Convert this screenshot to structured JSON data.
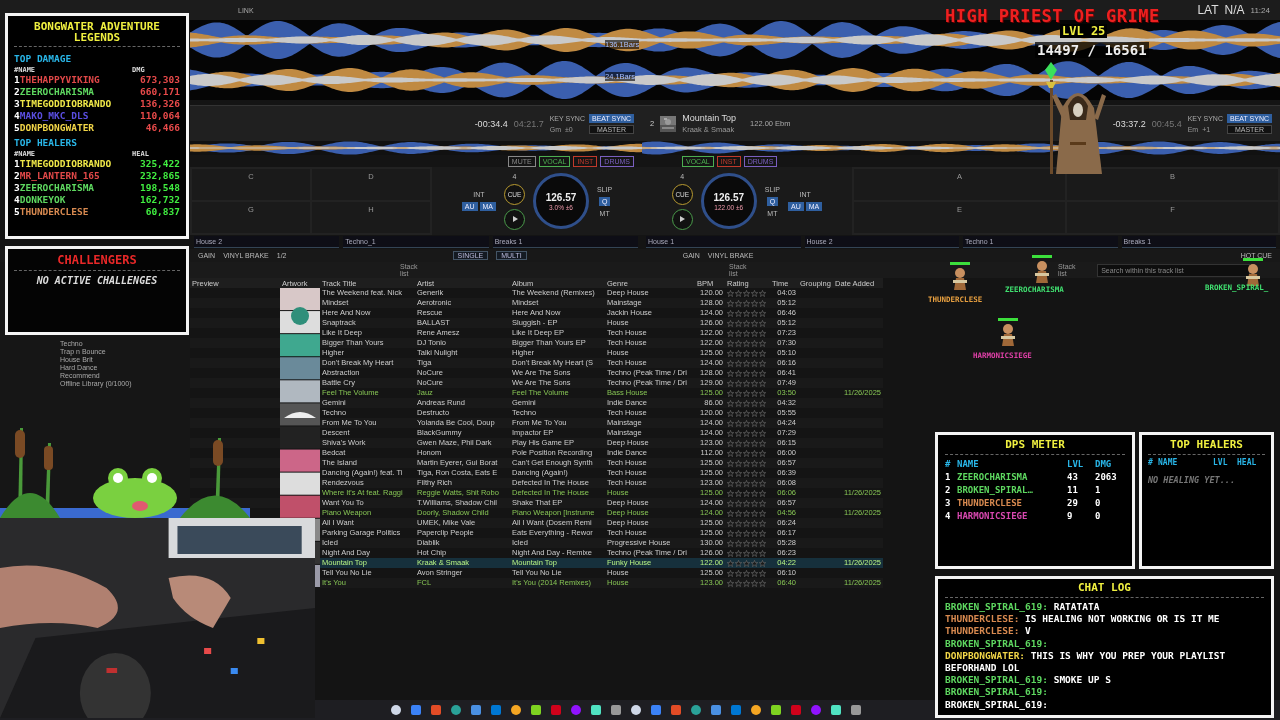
{
  "app": {
    "link_label": "LINK",
    "waveform_markers": [
      "136.1Bars",
      "24.1Bars"
    ],
    "status": {
      "lat_label": "LAT",
      "lat_value": "N/A",
      "clock": "11:24"
    },
    "decks": [
      {
        "time_remaining": "-00:34.4",
        "time_elapsed": "04:21.7",
        "key_sync": "KEY SYNC",
        "beat_sync": "BEAT SYNC",
        "master": "MASTER",
        "key": "Gm",
        "key_shift": "±0",
        "stems": [
          {
            "label": "MUTE",
            "color": "#888888"
          },
          {
            "label": "VOCAL",
            "color": "#4caf50"
          },
          {
            "label": "INST",
            "color": "#c0392b"
          },
          {
            "label": "DRUMS",
            "color": "#7a5fc0"
          }
        ],
        "pads": [
          "C",
          "D",
          "G",
          "H"
        ],
        "beat_jump": "4",
        "int": "INT",
        "cue": "CUE",
        "slip": "SLIP",
        "q": "Q",
        "modes": [
          "AU",
          "MA"
        ],
        "mt": "MT",
        "bpm": "126.57",
        "pitch": "3.0%",
        "range": "±6",
        "samples": [
          "House 2",
          "Techno_1",
          "Breaks 1"
        ]
      },
      {
        "number": "2",
        "title": "Mountain Top",
        "artist": "Kraak & Smaak",
        "track_info": "122.00 Ebm",
        "time_remaining": "-03:37.2",
        "time_elapsed": "00:45.4",
        "key_sync": "KEY SYNC",
        "beat_sync": "BEAT SYNC",
        "master": "MASTER",
        "key": "Em",
        "key_shift": "+1",
        "stems": [
          {
            "label": "VOCAL",
            "color": "#4caf50"
          },
          {
            "label": "INST",
            "color": "#c0392b"
          },
          {
            "label": "DRUMS",
            "color": "#7a5fc0"
          }
        ],
        "pads": [
          "A",
          "B",
          "E",
          "F"
        ],
        "beat_jump": "4",
        "int": "INT",
        "cue": "CUE",
        "slip": "SLIP",
        "q": "Q",
        "modes": [
          "AU",
          "MA"
        ],
        "mt": "MT",
        "bpm": "126.57",
        "pitch": "122.00",
        "range": "±6",
        "samples": [
          "House 1",
          "House 2",
          "Techno 1",
          "Breaks 1"
        ]
      }
    ],
    "strip_labels": {
      "left": [
        "GAIN",
        "VINYL BRAKE",
        "1/2"
      ],
      "center": [
        "SINGLE",
        "MULTI"
      ],
      "right": [
        "GAIN",
        "VINYL BRAKE"
      ],
      "hot_cue": "HOT CUE"
    },
    "stack_lists": [
      "Stack list",
      "Stack list",
      "Stack list"
    ],
    "search": {
      "placeholder": "Search within this track list"
    },
    "sidebar_items": [
      "Techno",
      "Trap n Bounce",
      "House Brit",
      "Hard Dance",
      "Recommend",
      "Offline Library (0/1000)"
    ],
    "table": {
      "columns": [
        "Preview",
        "Artwork",
        "Track Title",
        "Artist",
        "Album",
        "Genre",
        "BPM",
        "Rating",
        "Time",
        "Grouping",
        "Date Added"
      ],
      "rows": [
        {
          "title": "The Weekend feat. Nick",
          "artist": "Generik",
          "album": "The Weekend (Remixes)",
          "genre": "Deep House",
          "bpm": "120.00",
          "stars": 0,
          "time": "04:03",
          "played": false,
          "selected": false
        },
        {
          "title": "Mindset",
          "artist": "Aerotronic",
          "album": "Mindset",
          "genre": "Mainstage",
          "bpm": "128.00",
          "stars": 0,
          "time": "05:12",
          "played": false,
          "selected": false
        },
        {
          "title": "Here And Now",
          "artist": "Rescue",
          "album": "Here And Now",
          "genre": "Jackin House",
          "bpm": "124.00",
          "stars": 0,
          "time": "06:46",
          "played": false,
          "selected": false
        },
        {
          "title": "Snaptrack",
          "artist": "BALLAST",
          "album": "Sluggish - EP",
          "genre": "House",
          "bpm": "126.00",
          "stars": 0,
          "time": "05:12",
          "played": false,
          "selected": false
        },
        {
          "title": "Like It Deep",
          "artist": "Rene Amesz",
          "album": "Like It Deep EP",
          "genre": "Tech House",
          "bpm": "122.00",
          "stars": 0,
          "time": "07:23",
          "played": false,
          "selected": false
        },
        {
          "title": "Bigger Than Yours",
          "artist": "DJ Tonio",
          "album": "Bigger Than Yours EP",
          "genre": "Tech House",
          "bpm": "122.00",
          "stars": 0,
          "time": "07:30",
          "played": false,
          "selected": false
        },
        {
          "title": "Higher",
          "artist": "Talki Nulight",
          "album": "Higher",
          "genre": "House",
          "bpm": "125.00",
          "stars": 0,
          "time": "05:10",
          "played": false,
          "selected": false
        },
        {
          "title": "Don't Break My Heart",
          "artist": "Tiga",
          "album": "Don't Break My Heart (S",
          "genre": "Tech House",
          "bpm": "124.00",
          "stars": 0,
          "time": "06:16",
          "played": false,
          "selected": false
        },
        {
          "title": "Abstraction",
          "artist": "NoCure",
          "album": "We Are The Sons",
          "genre": "Techno (Peak Time / Dri",
          "bpm": "128.00",
          "stars": 0,
          "time": "06:41",
          "played": false,
          "selected": false
        },
        {
          "title": "Battle Cry",
          "artist": "NoCure",
          "album": "We Are The Sons",
          "genre": "Techno (Peak Time / Dri",
          "bpm": "129.00",
          "stars": 0,
          "time": "07:49",
          "played": false,
          "selected": false
        },
        {
          "title": "Feel The Volume",
          "artist": "Jauz",
          "album": "Feel The Volume",
          "genre": "Bass House",
          "bpm": "125.00",
          "stars": 0,
          "time": "03:50",
          "date_added": "11/26/2025",
          "played": true,
          "selected": false
        },
        {
          "title": "Gemini",
          "artist": "Andreas Rund",
          "album": "Gemini",
          "genre": "Indie Dance",
          "bpm": "86.00",
          "stars": 0,
          "time": "04:32",
          "played": false,
          "selected": false
        },
        {
          "title": "Techno",
          "artist": "Destructo",
          "album": "Techno",
          "genre": "Tech House",
          "bpm": "120.00",
          "stars": 0,
          "time": "05:55",
          "played": false,
          "selected": false
        },
        {
          "title": "From Me To You",
          "artist": "Yolanda Be Cool, Doup",
          "album": "From Me To You",
          "genre": "Mainstage",
          "bpm": "124.00",
          "stars": 0,
          "time": "04:24",
          "played": false,
          "selected": false
        },
        {
          "title": "Descent",
          "artist": "BlackGummy",
          "album": "Impactor EP",
          "genre": "Mainstage",
          "bpm": "124.00",
          "stars": 0,
          "time": "07:29",
          "played": false,
          "selected": false
        },
        {
          "title": "Shiva's Work",
          "artist": "Gwen Maze, Phil Dark",
          "album": "Play His Game EP",
          "genre": "Deep House",
          "bpm": "123.00",
          "stars": 0,
          "time": "06:15",
          "played": false,
          "selected": false
        },
        {
          "title": "Bedcat",
          "artist": "Honom",
          "album": "Pole Position Recording",
          "genre": "Indie Dance",
          "bpm": "112.00",
          "stars": 0,
          "time": "06:00",
          "played": false,
          "selected": false
        },
        {
          "title": "The Island",
          "artist": "Martin Eyerer, Gui Borat",
          "album": "Can't Get Enough Synth",
          "genre": "Tech House",
          "bpm": "125.00",
          "stars": 0,
          "time": "06:57",
          "played": false,
          "selected": false
        },
        {
          "title": "Dancing (Again!) feat. Ti",
          "artist": "Tiga, Ron Costa, Eats E",
          "album": "Dancing (Again!)",
          "genre": "Tech House",
          "bpm": "125.00",
          "stars": 0,
          "time": "06:39",
          "played": false,
          "selected": false
        },
        {
          "title": "Rendezvous",
          "artist": "Filthy Rich",
          "album": "Defected In The House",
          "genre": "Tech House",
          "bpm": "123.00",
          "stars": 0,
          "time": "06:08",
          "played": false,
          "selected": false
        },
        {
          "title": "Where It's At feat. Raggi",
          "artist": "Reggie Watts, Shit Robo",
          "album": "Defected In The House",
          "genre": "House",
          "bpm": "125.00",
          "stars": 0,
          "time": "06:06",
          "date_added": "11/26/2025",
          "played": true,
          "selected": false
        },
        {
          "title": "Want You To",
          "artist": "T.Williams, Shadow Chil",
          "album": "Shake That EP",
          "genre": "Deep House",
          "bpm": "124.00",
          "stars": 0,
          "time": "06:57",
          "played": false,
          "selected": false
        },
        {
          "title": "Piano Weapon",
          "artist": "Doorly, Shadow Child",
          "album": "Piano Weapon [Instrume",
          "genre": "Deep House",
          "bpm": "124.00",
          "stars": 0,
          "time": "04:56",
          "date_added": "11/26/2025",
          "played": true,
          "selected": false
        },
        {
          "title": "All I Want",
          "artist": "UMEK, Mike Vale",
          "album": "All I Want (Dosem Remi",
          "genre": "Deep House",
          "bpm": "125.00",
          "stars": 0,
          "time": "06:24",
          "played": false,
          "selected": false
        },
        {
          "title": "Parking Garage Politics",
          "artist": "Paperclip People",
          "album": "Eats Everything - Rewor",
          "genre": "Tech House",
          "bpm": "125.00",
          "stars": 0,
          "time": "06:17",
          "played": false,
          "selected": false
        },
        {
          "title": "Icled",
          "artist": "Diablik",
          "album": "Icled",
          "genre": "Progressive House",
          "bpm": "130.00",
          "stars": 0,
          "time": "05:28",
          "played": false,
          "selected": false
        },
        {
          "title": "Night And Day",
          "artist": "Hot Chip",
          "album": "Night And Day - Remixe",
          "genre": "Techno (Peak Time / Dri",
          "bpm": "126.00",
          "stars": 0,
          "time": "06:23",
          "played": false,
          "selected": false
        },
        {
          "title": "Mountain Top",
          "artist": "Kraak & Smaak",
          "album": "Mountain Top",
          "genre": "Funky House",
          "bpm": "122.00",
          "stars": 0,
          "time": "04:22",
          "date_added": "11/26/2025",
          "played": true,
          "selected": true
        },
        {
          "title": "Tell You No Lie",
          "artist": "Avon Stringer",
          "album": "Tell You No Lie",
          "genre": "House",
          "bpm": "125.00",
          "stars": 0,
          "time": "06:10",
          "played": false,
          "selected": false
        },
        {
          "title": "It's You",
          "artist": "FCL",
          "album": "It's You (2014 Remixes)",
          "genre": "House",
          "bpm": "123.00",
          "stars": 0,
          "time": "06:40",
          "date_added": "11/26/2025",
          "played": true,
          "selected": false
        }
      ]
    }
  },
  "overlay": {
    "leaderboard": {
      "title": "BONGWATER ADVENTURE LEGENDS",
      "sections": [
        {
          "title": "TOP DAMAGE",
          "hash": "#",
          "name_label": "NAME",
          "value_label": "DMG",
          "kind": "damage",
          "entries": [
            {
              "rank": "1",
              "name": "THEHAPPYVIKING",
              "value": "673,303",
              "color": "#e04848"
            },
            {
              "rank": "2",
              "name": "ZEEROCHARISMA",
              "value": "660,171",
              "color": "#5ed860"
            },
            {
              "rank": "3",
              "name": "TIMEGODDIOBRANDO",
              "value": "136,326",
              "color": "#f0e848"
            },
            {
              "rank": "4",
              "name": "MAKO_MKC_DLS",
              "value": "110,064",
              "color": "#5a4ee0"
            },
            {
              "rank": "5",
              "name": "DONPBONGWATER",
              "value": "46,466",
              "color": "#f2d648"
            }
          ]
        },
        {
          "title": "TOP HEALERS",
          "hash": "#",
          "name_label": "NAME",
          "value_label": "HEAL",
          "kind": "healing",
          "entries": [
            {
              "rank": "1",
              "name": "TIMEGODDIOBRANDO",
              "value": "325,422",
              "color": "#f0e848"
            },
            {
              "rank": "2",
              "name": "MR_LANTERN_165",
              "value": "232,865",
              "color": "#e04848"
            },
            {
              "rank": "3",
              "name": "ZEEROCHARISMA",
              "value": "198,548",
              "color": "#5ed860"
            },
            {
              "rank": "4",
              "name": "DONKEYOK",
              "value": "162,732",
              "color": "#5ed860"
            },
            {
              "rank": "5",
              "name": "THUNDERCLESE",
              "value": "60,837",
              "color": "#d88a50"
            }
          ]
        }
      ]
    },
    "challengers": {
      "title": "CHALLENGERS",
      "message": "NO ACTIVE CHALLENGES"
    },
    "boss": {
      "name": "HIGH PRIEST OF GRIME",
      "level": "LVL 25",
      "hp": "14497 / 16561"
    },
    "heroes": [
      {
        "name": "THUNDERCLESE",
        "color": "#e8a040"
      },
      {
        "name": "ZEEROCHARISMA",
        "color": "#40e070"
      },
      {
        "name": "BROKEN_SPIRAL_",
        "color": "#40e070"
      },
      {
        "name": "HARMONICSIEGE",
        "color": "#e040a8"
      }
    ],
    "dps_meter": {
      "title": "DPS METER",
      "columns": [
        "#",
        "NAME",
        "LVL",
        "DMG"
      ],
      "rows": [
        {
          "rank": "1",
          "name": "ZEEROCHARISMA",
          "lvl": "43",
          "dmg": "2063",
          "color": "#5ed860"
        },
        {
          "rank": "2",
          "name": "BROKEN_SPIRAL…",
          "lvl": "11",
          "dmg": "1",
          "color": "#5ed860"
        },
        {
          "rank": "3",
          "name": "THUNDERCLESE",
          "lvl": "29",
          "dmg": "0",
          "color": "#d88a50"
        },
        {
          "rank": "4",
          "name": "HARMONICSIEGE",
          "lvl": "9",
          "dmg": "0",
          "color": "#d848b0"
        }
      ]
    },
    "top_healers": {
      "title": "TOP HEALERS",
      "columns": [
        "#",
        "NAME",
        "LVL",
        "HEAL"
      ],
      "empty": "NO HEALING YET..."
    },
    "chat": {
      "title": "CHAT LOG",
      "messages": [
        {
          "user": "BROKEN_SPIRAL_619:",
          "text": "RATATATA",
          "color": "#5ed860"
        },
        {
          "user": "THUNDERCLESE:",
          "text": "IS HEALING NOT WORKING OR IS IT ME",
          "color": "#d88a50"
        },
        {
          "user": "THUNDERCLESE:",
          "text": "V",
          "color": "#d88a50"
        },
        {
          "user": "BROKEN_SPIRAL_619:",
          "color": "#5ed860"
        },
        {
          "user": "DONPBONGWATER:",
          "text": "THIS IS WHY YOU PREP YOUR PLAYLIST BEFORHAND LOL",
          "color": "#f2d648"
        },
        {
          "user": "BROKEN_SPIRAL_619:",
          "text": "SMOKE UP S",
          "color": "#5ed860"
        },
        {
          "user": "BROKEN_SPIRAL_619:",
          "color": "#5ed860"
        },
        {
          "user": "BROKEN_SPIRAL_619:",
          "color": "#ffffff"
        }
      ]
    }
  }
}
